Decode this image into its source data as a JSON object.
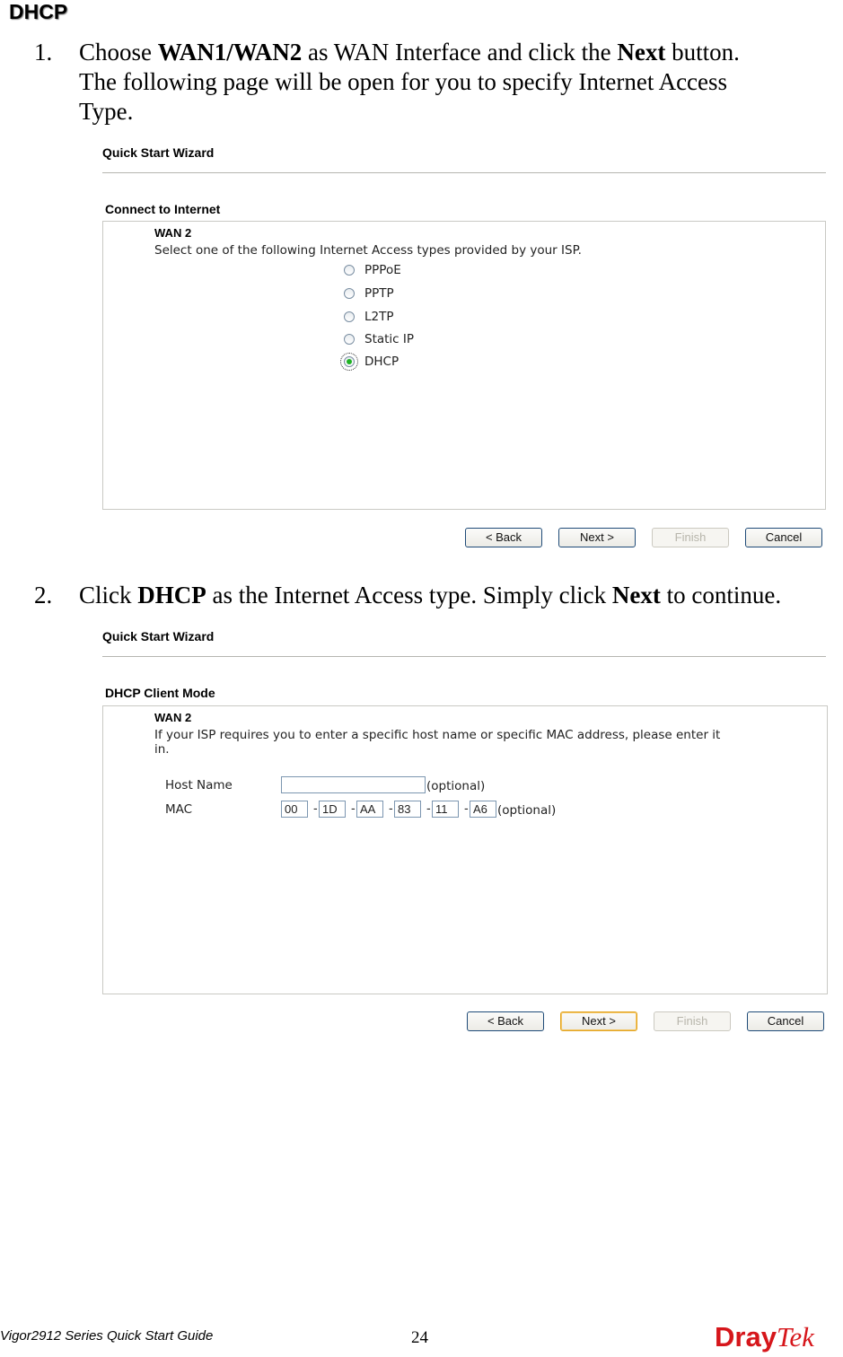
{
  "section_heading": "DHCP",
  "steps": [
    {
      "number": "1.",
      "line1_pre": "Choose ",
      "line1_bold1": "WAN1/WAN2",
      "line1_mid": " as WAN Interface and click the ",
      "line1_bold2": "Next",
      "line1_post": " button.",
      "line2": "The following page will be open for you to specify Internet Access",
      "line3": "Type."
    },
    {
      "number": "2.",
      "pre": "Click ",
      "bold1": "DHCP",
      "mid": " as the Internet Access type. Simply click ",
      "bold2": "Next",
      "post": " to continue."
    }
  ],
  "wizard1": {
    "title": "Quick Start Wizard",
    "subtitle": "Connect to Internet",
    "wan_label": "WAN 2",
    "description": "Select one of the following Internet Access types provided by your ISP.",
    "options": [
      {
        "label": "PPPoE",
        "checked": false
      },
      {
        "label": "PPTP",
        "checked": false
      },
      {
        "label": "L2TP",
        "checked": false
      },
      {
        "label": "Static IP",
        "checked": false
      },
      {
        "label": "DHCP",
        "checked": true
      }
    ],
    "buttons": {
      "back": "< Back",
      "next": "Next >",
      "finish": "Finish",
      "cancel": "Cancel"
    }
  },
  "wizard2": {
    "title": "Quick Start Wizard",
    "subtitle": "DHCP Client Mode",
    "wan_label": "WAN 2",
    "description_line1": "If your ISP requires you to enter a specific host name or specific MAC address, please enter it",
    "description_line2": "in.",
    "host_name": {
      "label": "Host Name",
      "value": "",
      "note": "(optional)"
    },
    "mac": {
      "label": "MAC",
      "octets": [
        "00",
        "1D",
        "AA",
        "83",
        "11",
        "A6"
      ],
      "separator": "-",
      "note": "(optional)"
    },
    "buttons": {
      "back": "< Back",
      "next": "Next >",
      "finish": "Finish",
      "cancel": "Cancel"
    }
  },
  "footer": {
    "guide_title": "Vigor2912 Series Quick Start Guide",
    "page_number": "24",
    "logo_part1": "Dray",
    "logo_part2": "Tek",
    "logo_color": "#d6161b"
  }
}
